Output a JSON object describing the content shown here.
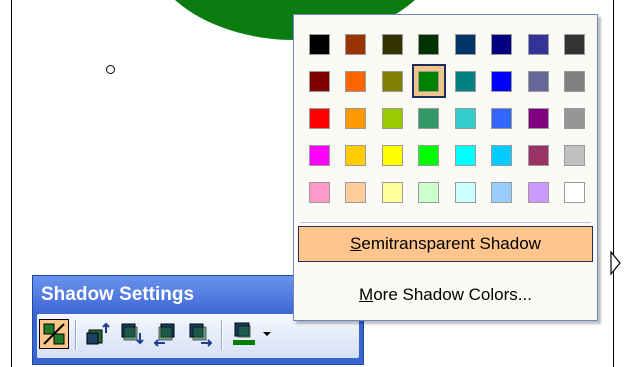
{
  "popup": {
    "swatches": [
      [
        "#000000",
        "#993300",
        "#333300",
        "#003300",
        "#003366",
        "#000080",
        "#333399",
        "#333333"
      ],
      [
        "#800000",
        "#ff6600",
        "#808000",
        "#008000",
        "#008080",
        "#0000ff",
        "#666699",
        "#808080"
      ],
      [
        "#ff0000",
        "#ff9900",
        "#99cc00",
        "#339966",
        "#33cccc",
        "#3366ff",
        "#800080",
        "#969696"
      ],
      [
        "#ff00ff",
        "#ffcc00",
        "#ffff00",
        "#00ff00",
        "#00ffff",
        "#00ccff",
        "#993366",
        "#c0c0c0"
      ],
      [
        "#ff99cc",
        "#ffcc99",
        "#ffff99",
        "#ccffcc",
        "#ccffff",
        "#99ccff",
        "#cc99ff",
        "#ffffff"
      ]
    ],
    "selected": {
      "row": 1,
      "col": 3
    },
    "semitransparent_prefix": "S",
    "semitransparent_rest": "emitransparent Shadow",
    "more_prefix": "M",
    "more_rest": "ore Shadow Colors..."
  },
  "toolbar": {
    "title": "Shadow Settings",
    "shadow_color": "#008000"
  },
  "colors": {
    "toolbar_blue": "#3a66d4",
    "highlight": "#ffc58c",
    "shape_green": "#0a7c10"
  }
}
